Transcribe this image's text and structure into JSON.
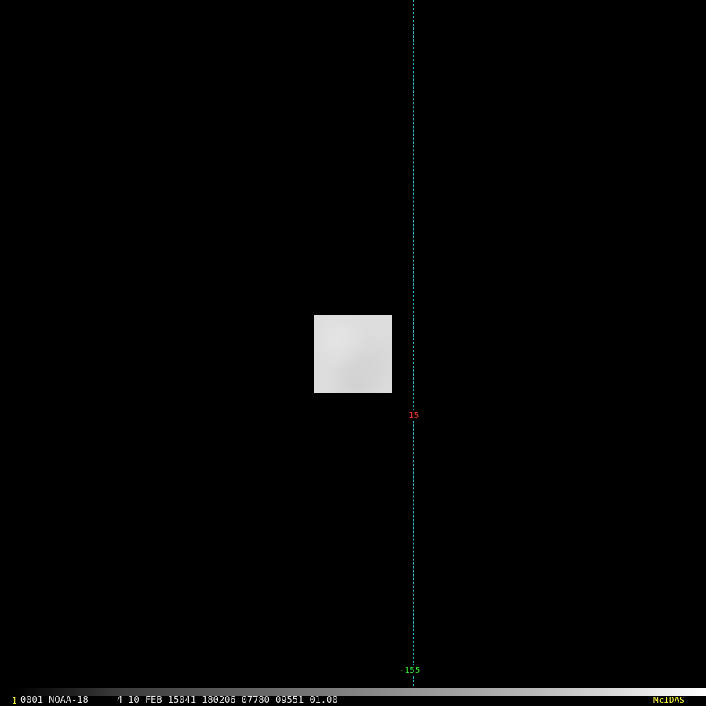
{
  "viewer": {
    "frame_number": "1",
    "info_line": "0001 NOAA-18     4 10 FEB 15041 180206 07780 09551 01.00",
    "brand": "McIDAS"
  },
  "grid": {
    "latitude_label": "15",
    "longitude_label": "-155",
    "line_color": "#2fb8c8",
    "latitude_label_color": "#ff3030",
    "longitude_label_color": "#30e030"
  },
  "colors": {
    "background": "#000000",
    "status_text": "#e8e8e8",
    "accent_yellow": "#ffff40",
    "image_tile": "#dcdcdc"
  }
}
